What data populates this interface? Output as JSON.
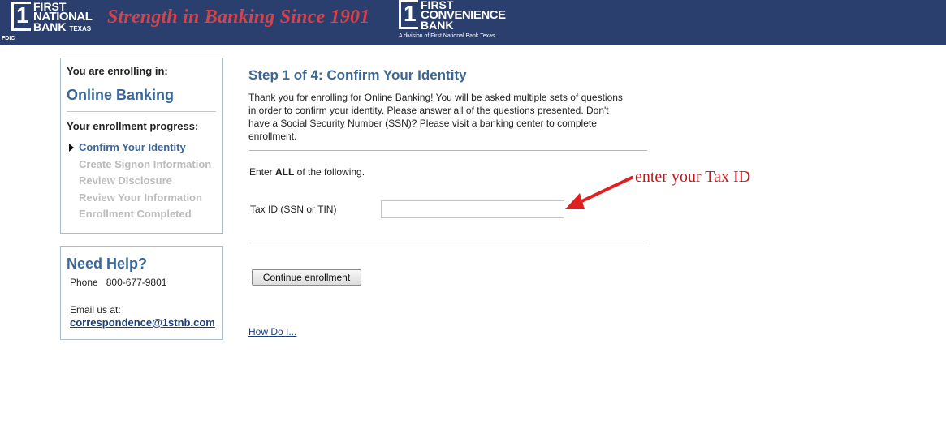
{
  "header": {
    "logo1": {
      "line1": "FIRST",
      "line2": "NATIONAL",
      "line3": "BANK",
      "sub": "TEXAS",
      "mark": "1"
    },
    "fdic": "FDIC",
    "slogan": "Strength in Banking Since 1901",
    "logo2": {
      "line1": "FIRST",
      "line2": "CONVENIENCE",
      "line3": "BANK",
      "mark": "1",
      "division": "A division of First National Bank Texas"
    },
    "colors": {
      "banner": "#2a3f6d",
      "slogan": "#d3434b"
    }
  },
  "sidebar": {
    "enrolling_label": "You are enrolling in:",
    "enrolling_title": "Online Banking",
    "progress_label": "Your enrollment progress:",
    "steps": [
      "Confirm Your Identity",
      "Create Signon Information",
      "Review Disclosure",
      "Review Your Information",
      "Enrollment Completed"
    ],
    "current_step_index": 0,
    "help": {
      "title": "Need Help?",
      "phone_label": "Phone",
      "phone": "800-677-9801",
      "email_label": "Email us at:",
      "email": "correspondence@1stnb.com"
    }
  },
  "main": {
    "title": "Step 1 of 4: Confirm Your Identity",
    "intro": "Thank you for enrolling for Online Banking! You will be asked multiple sets of questions in order to confirm your identity. Please answer all of the questions presented. Don't have a Social Security Number (SSN)? Please visit a banking center to complete enrollment.",
    "enter_prefix": "Enter ",
    "enter_bold": "ALL",
    "enter_suffix": " of the following.",
    "field_label": "Tax ID (SSN or TIN)",
    "field_value": "",
    "continue_button": "Continue enrollment",
    "how_do_i": "How Do I..."
  },
  "annotation": {
    "text": "enter your Tax ID",
    "color": "#c4161c"
  },
  "accent_color": "#3a6798"
}
